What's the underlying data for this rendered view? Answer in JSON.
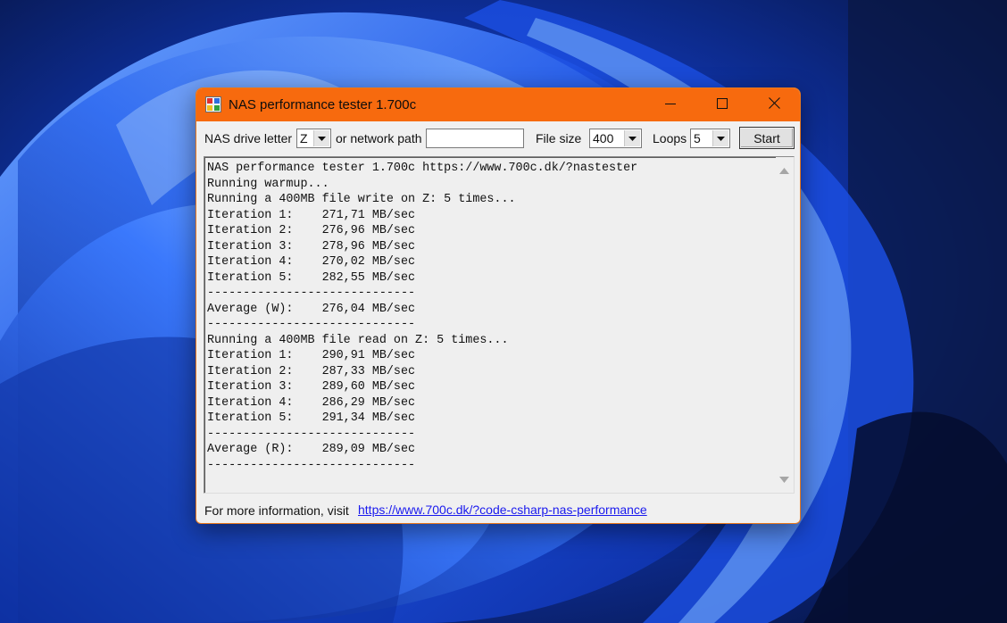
{
  "window": {
    "title": "NAS performance tester 1.700c",
    "accent_color": "#f76a0e"
  },
  "toolbar": {
    "drive_label": "NAS drive letter",
    "drive_value": "Z",
    "path_label": "or network path",
    "path_value": "",
    "filesize_label": "File size",
    "filesize_value": "400",
    "loops_label": "Loops",
    "loops_value": "5",
    "start_label": "Start"
  },
  "log": {
    "lines": [
      "NAS performance tester 1.700c https://www.700c.dk/?nastester",
      "Running warmup...",
      "Running a 400MB file write on Z: 5 times...",
      "Iteration 1:    271,71 MB/sec",
      "Iteration 2:    276,96 MB/sec",
      "Iteration 3:    278,96 MB/sec",
      "Iteration 4:    270,02 MB/sec",
      "Iteration 5:    282,55 MB/sec",
      "-----------------------------",
      "Average (W):    276,04 MB/sec",
      "-----------------------------",
      "Running a 400MB file read on Z: 5 times...",
      "Iteration 1:    290,91 MB/sec",
      "Iteration 2:    287,33 MB/sec",
      "Iteration 3:    289,60 MB/sec",
      "Iteration 4:    286,29 MB/sec",
      "Iteration 5:    291,34 MB/sec",
      "-----------------------------",
      "Average (R):    289,09 MB/sec",
      "-----------------------------"
    ]
  },
  "footer": {
    "info_label": "For more information, visit",
    "link_text": "https://www.700c.dk/?code-csharp-nas-performance"
  },
  "icons": [
    "app-icon",
    "minimize-icon",
    "maximize-icon",
    "close-icon",
    "dropdown-arrow-icon",
    "scroll-up-icon",
    "scroll-down-icon"
  ]
}
